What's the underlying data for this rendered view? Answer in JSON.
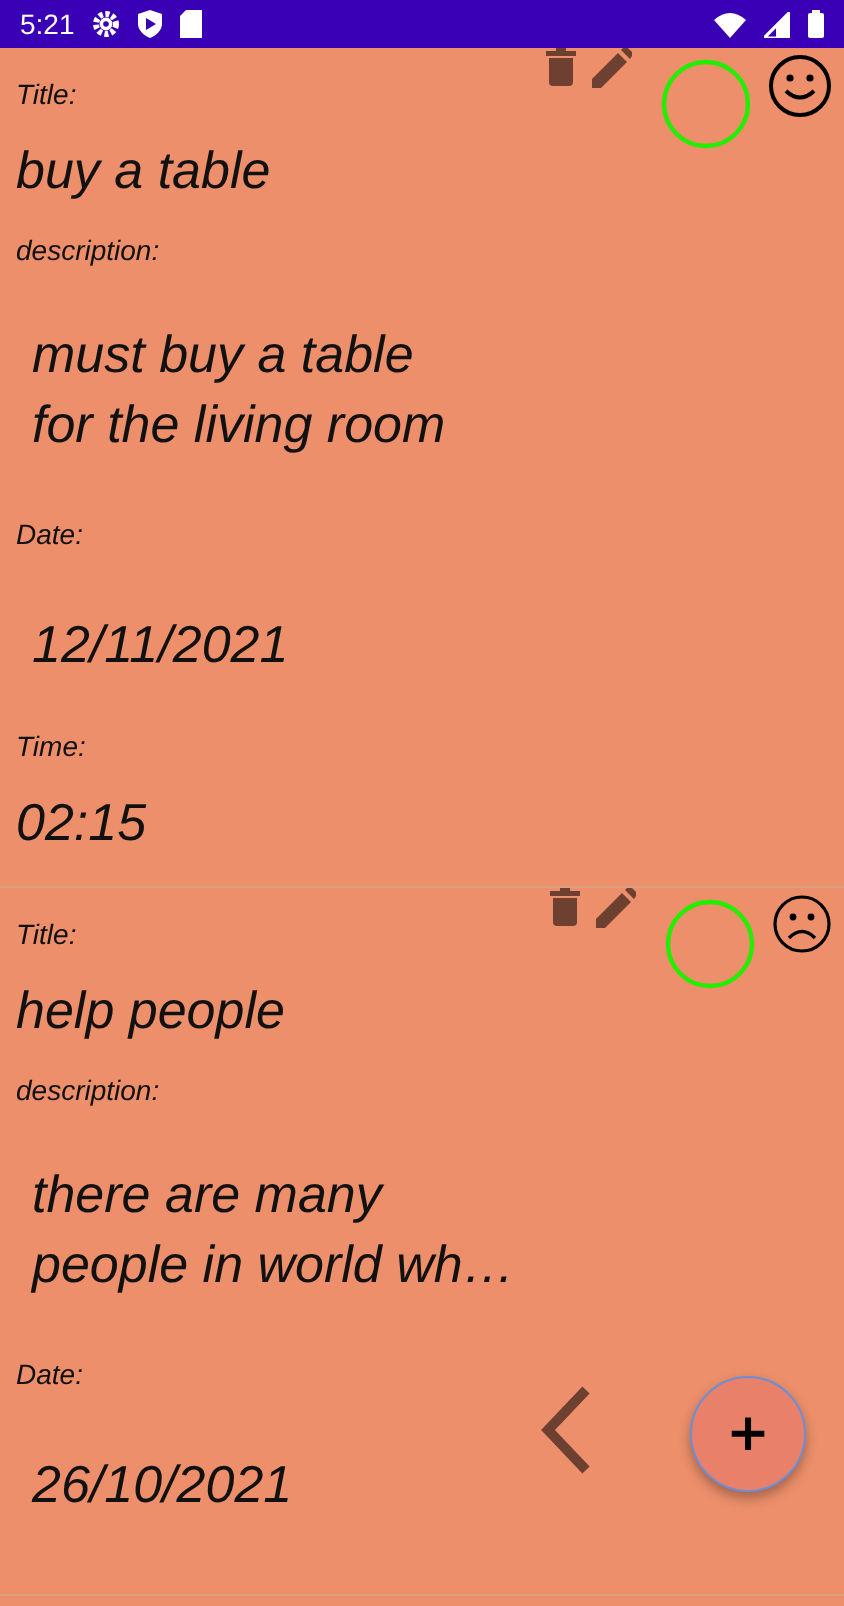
{
  "status_bar": {
    "time": "5:21"
  },
  "notes": [
    {
      "title_label": "Title:",
      "title": "buy a table",
      "description_label": "description:",
      "description": "must buy a table\nfor the living room",
      "date_label": "Date:",
      "date": "12/11/2021",
      "time_label": "Time:",
      "time": "02:15",
      "kind": "happy"
    },
    {
      "title_label": "Title:",
      "title": "help people",
      "description_label": "description:",
      "description": "there are many\npeople in world wh…",
      "date_label": "Date:",
      "date": "26/10/2021",
      "kind": "sad"
    }
  ],
  "fab": {
    "symbol": "+"
  }
}
